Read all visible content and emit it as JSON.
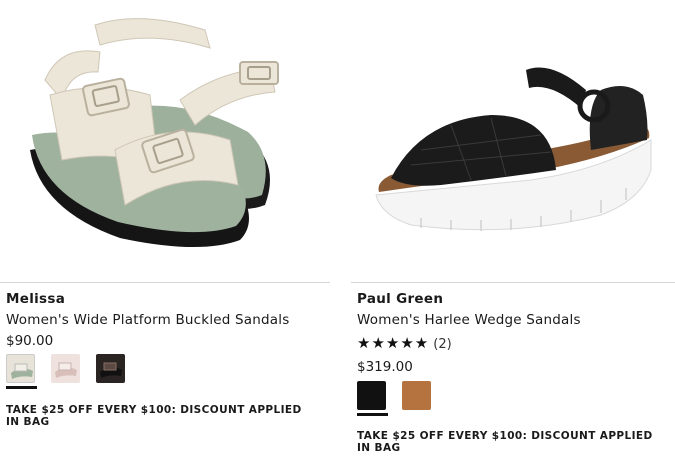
{
  "products": [
    {
      "brand": "Melissa",
      "name": "Women's Wide Platform Buckled Sandals",
      "price": "$90.00",
      "swatches": [
        {
          "name": "white-sage",
          "color": "#e7e3d8",
          "selected": true
        },
        {
          "name": "pink",
          "color": "#e9d6d2",
          "selected": false
        },
        {
          "name": "black-print",
          "color": "#2a2422",
          "selected": false
        }
      ],
      "promo": "TAKE $25 OFF EVERY $100: DISCOUNT APPLIED IN BAG"
    },
    {
      "brand": "Paul Green",
      "name": "Women's Harlee Wedge Sandals",
      "rating_stars": "★★★★★",
      "rating_count": "(2)",
      "price": "$319.00",
      "swatches": [
        {
          "name": "black",
          "color": "#111111",
          "selected": true
        },
        {
          "name": "tan",
          "color": "#b4733f",
          "selected": false
        }
      ],
      "promo": "TAKE $25 OFF EVERY $100: DISCOUNT APPLIED IN BAG"
    }
  ],
  "colors": {
    "text": "#1a1a1a",
    "rule": "#d6d6d6",
    "sage": "#9caf9b",
    "cream": "#ece6d8"
  }
}
